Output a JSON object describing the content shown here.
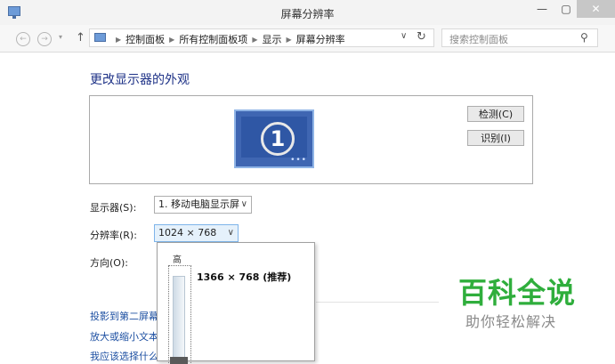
{
  "window": {
    "title": "屏幕分辨率",
    "minimize": "—",
    "maximize": "▢",
    "close": "✕"
  },
  "nav": {
    "back": "←",
    "forward": "→",
    "history": "▾",
    "up": "↑"
  },
  "address": {
    "crumbs": [
      "控制面板",
      "所有控制面板项",
      "显示",
      "屏幕分辨率"
    ],
    "dropdown": "∨",
    "refresh": "↻"
  },
  "search": {
    "placeholder": "搜索控制面板",
    "icon": "⚲"
  },
  "main": {
    "heading": "更改显示器的外观",
    "monitor_number": "1",
    "monitor_dots": "•••",
    "detect_button": "检测(C)",
    "identify_button": "识别(I)",
    "display_label": "显示器(S):",
    "display_value": "1. 移动电脑显示屏",
    "resolution_label": "分辨率(R):",
    "resolution_value": "1024 × 768",
    "orientation_label": "方向(O):",
    "dropdown_arrow": "∨"
  },
  "resolution_popup": {
    "high_label": "高",
    "option": "1366 × 768 (推荐)"
  },
  "links": [
    "投影到第二屏幕",
    "放大或缩小文本",
    "我应该选择什么"
  ],
  "watermark": {
    "title": "百科全说",
    "subtitle": "助你轻松解决"
  },
  "colors": {
    "heading": "#1e3287",
    "link": "#1e50a2",
    "watermark": "#2fae3c"
  }
}
